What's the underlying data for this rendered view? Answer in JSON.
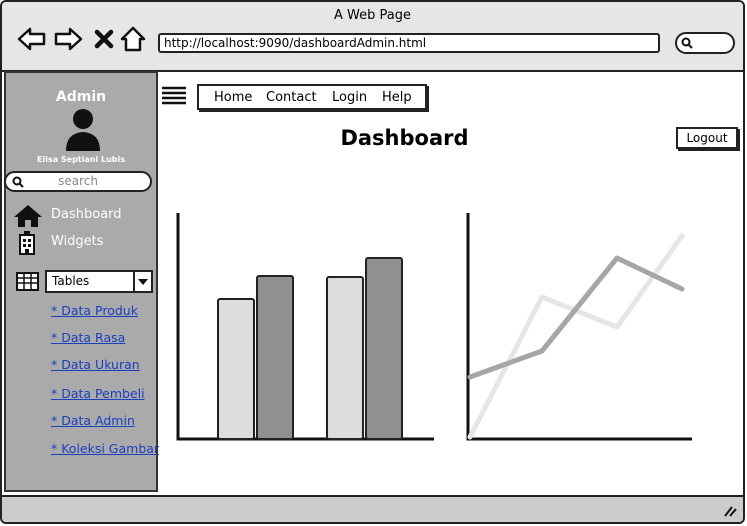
{
  "window": {
    "title": "A Web Page"
  },
  "browser": {
    "url": "http://localhost:9090/dashboardAdmin.html",
    "icons": [
      "back-arrow-icon",
      "forward-arrow-icon",
      "stop-icon",
      "home-icon",
      "search-icon"
    ]
  },
  "sidebar": {
    "title": "Admin",
    "user_name": "Elisa Septiani Lubis",
    "search_placeholder": "search",
    "items": [
      {
        "label": "Dashboard",
        "icon": "home-icon"
      },
      {
        "label": "Widgets",
        "icon": "building-icon"
      }
    ],
    "tables": {
      "selected": "Tables",
      "icon": "table-icon",
      "links": [
        "* Data Produk",
        "* Data Rasa",
        "* Data Ukuran",
        "* Data Pembeli",
        "* Data Admin",
        "* Koleksi Gambar"
      ]
    }
  },
  "topnav": {
    "items": [
      "Home",
      "Contact",
      "Login",
      "Help"
    ]
  },
  "main": {
    "title": "Dashboard",
    "logout_label": "Logout"
  },
  "chart_data": [
    {
      "type": "bar",
      "categories": [
        "",
        ""
      ],
      "series": [
        {
          "values": [
            140,
            162
          ],
          "color": "#dddddd"
        },
        {
          "values": [
            163,
            181
          ],
          "color": "#909090"
        }
      ],
      "ylim": [
        0,
        225
      ]
    },
    {
      "type": "line",
      "x": [
        0,
        1,
        2,
        3
      ],
      "series": [
        {
          "values": [
            2,
            142,
            112,
            203
          ],
          "color": "#e6e6e6"
        },
        {
          "values": [
            62,
            88,
            181,
            150
          ],
          "color": "#a6a6a6"
        }
      ],
      "ylim": [
        0,
        225
      ]
    }
  ]
}
